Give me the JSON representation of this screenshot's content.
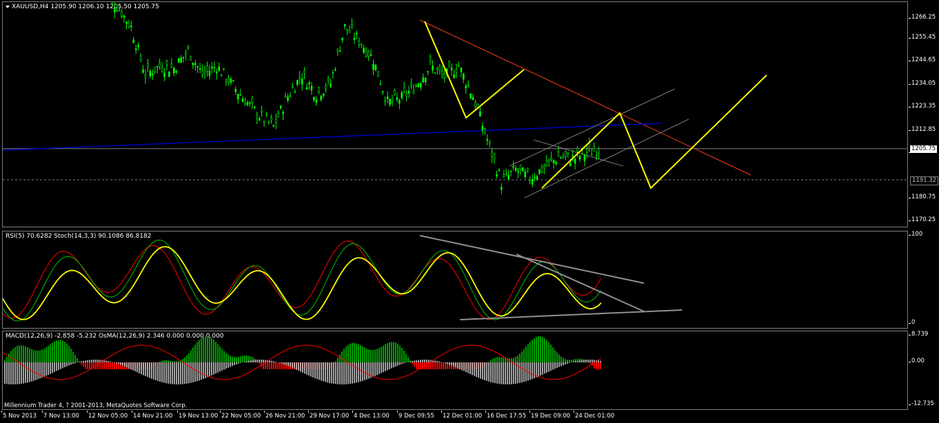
{
  "symbol_header": "XAUUSD,H4  1205.90 1206.10 1205.50 1205.75",
  "rsi_header": "RSI(5) 70.6282  Stoch(14,3,3) 90.1086 86.8182",
  "macd_header": "MACD(12,26,9) -2.858 -5.232  OsMA(12,26,9) 2.346 0.000 0.000 0.000",
  "copyright": "Millennium Trader 4, ? 2001-2013, MetaQuotes Software Corp.",
  "price_scale": [
    "1266.25",
    "1255.45",
    "1244.65",
    "1234.05",
    "1223.35",
    "1212.85",
    "1202.05",
    "1191.32",
    "1180.75",
    "1170.25"
  ],
  "current_price": "1205.75",
  "line_price": "1191.32",
  "rsi_scale": [
    "100",
    "0"
  ],
  "macd_scale": [
    "8.739",
    "0.00",
    "-12.735"
  ],
  "time_axis": [
    "5 Nov 2013",
    "7 Nov 13:00",
    "12 Nov 05:00",
    "14 Nov 21:00",
    "19 Nov 13:00",
    "22 Nov 05:00",
    "26 Nov 21:00",
    "29 Nov 17:00",
    "4 Dec 13:00",
    "9 Dec 09:55",
    "12 Dec 01:00",
    "16 Dec 17:55",
    "19 Dec 09:00",
    "24 Dec 01:00"
  ],
  "colors": {
    "candle": "#00ff00",
    "channel": "#ff3b1f",
    "trend_blue": "#0000c8",
    "forecast": "#ffff00",
    "rsi_line": "#ffff00",
    "stoch_main": "#00c000",
    "stoch_signal": "#ff0000",
    "macd_pos": "#00a000",
    "macd_neg": "#ff0000",
    "macd_hist": "#c0c0c0"
  },
  "chart_data": {
    "type": "line",
    "title": "XAUUSD,H4",
    "series": [
      {
        "name": "XAUUSD,H4",
        "values": [
          1279,
          1272,
          1262,
          1240,
          1244,
          1243,
          1251,
          1240,
          1244,
          1236,
          1228,
          1221,
          1216,
          1230,
          1240,
          1231,
          1236,
          1262,
          1256,
          1247,
          1227,
          1229,
          1235,
          1244,
          1239,
          1244,
          1230,
          1210,
          1190,
          1196,
          1192,
          1197,
          1202,
          1201,
          1204,
          1205.75
        ]
      }
    ],
    "ylim": [
      1170.25,
      1272
    ]
  }
}
